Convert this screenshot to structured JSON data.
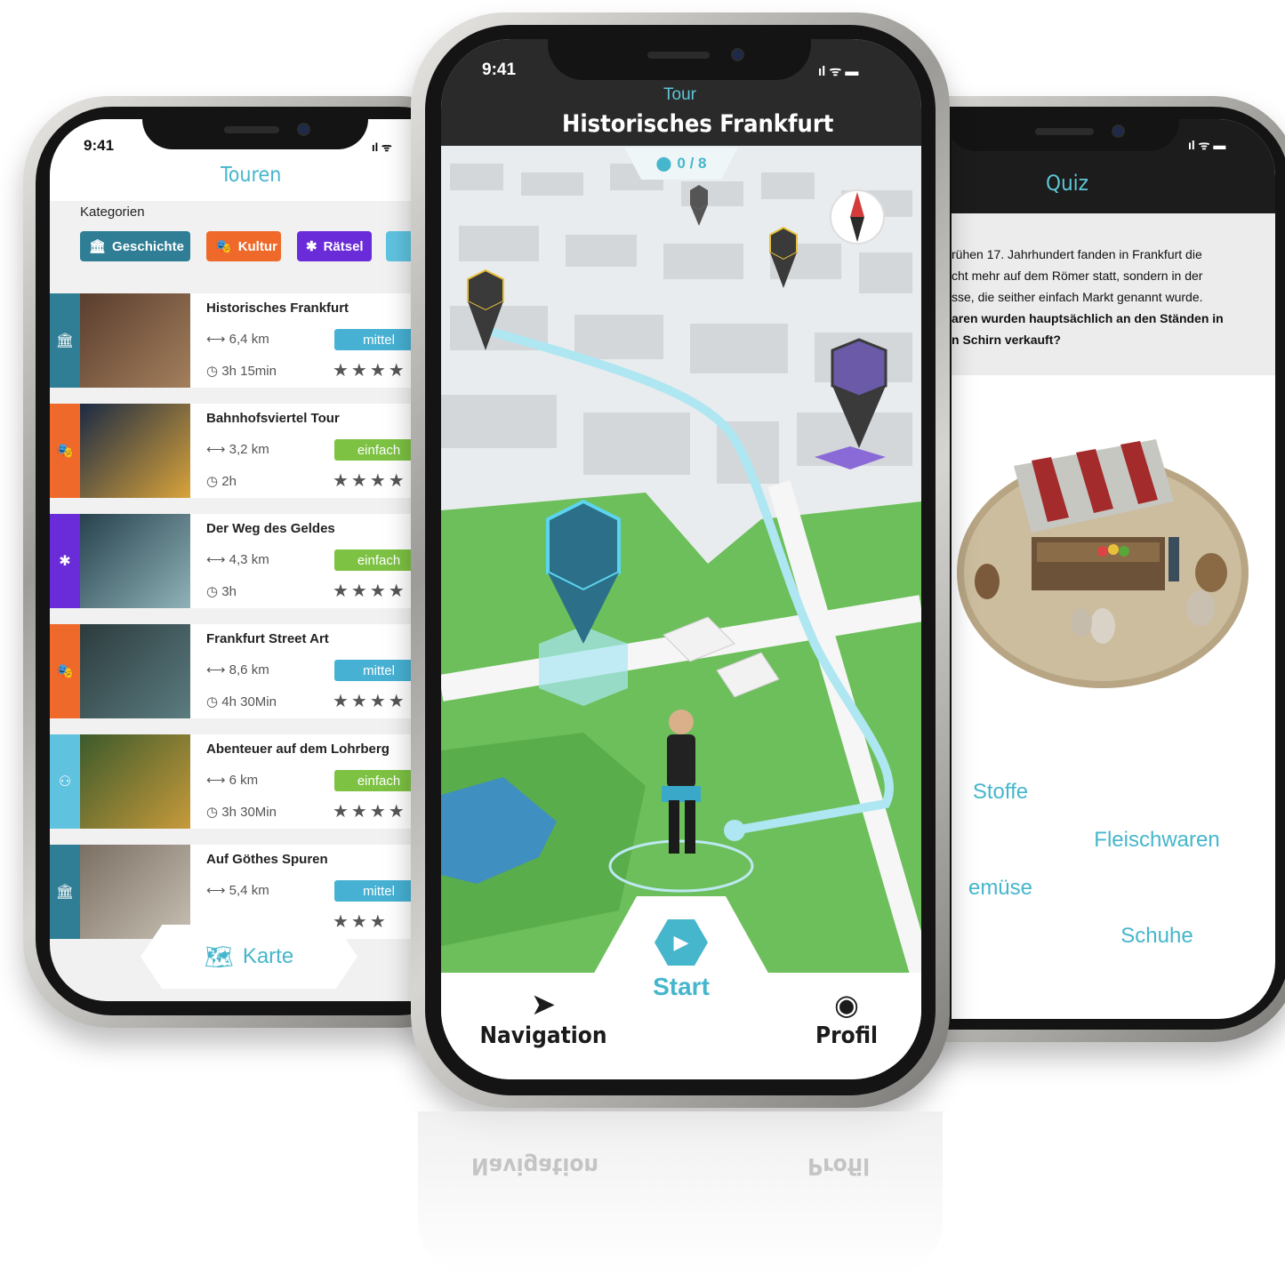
{
  "left_phone": {
    "status_time": "9:41",
    "title": "Touren",
    "categories_label": "Kategorien",
    "categories": [
      {
        "label": "Geschichte",
        "icon": "column-icon",
        "color": "#2f7e95"
      },
      {
        "label": "Kultur",
        "icon": "mask-icon",
        "color": "#ef6a2a"
      },
      {
        "label": "Rätsel",
        "icon": "puzzle-icon",
        "color": "#6a2bd9"
      }
    ],
    "tours": [
      {
        "title": "Historisches Frankfurt",
        "distance": "6,4 km",
        "duration": "3h 15min",
        "level": "mittel",
        "level_color": "#47b1d4",
        "cat_color": "#2f7e95",
        "cat_icon": "column-icon",
        "stars": "★★★★"
      },
      {
        "title": "Bahnhofsviertel Tour",
        "distance": "3,2 km",
        "duration": "2h",
        "level": "einfach",
        "level_color": "#7dc243",
        "cat_color": "#ef6a2a",
        "cat_icon": "mask-icon",
        "stars": "★★★★"
      },
      {
        "title": "Der Weg des Geldes",
        "distance": "4,3 km",
        "duration": "3h",
        "level": "einfach",
        "level_color": "#7dc243",
        "cat_color": "#6a2bd9",
        "cat_icon": "puzzle-icon",
        "stars": "★★★★"
      },
      {
        "title": "Frankfurt Street Art",
        "distance": "8,6 km",
        "duration": "4h 30Min",
        "level": "mittel",
        "level_color": "#47b1d4",
        "cat_color": "#ef6a2a",
        "cat_icon": "mask-icon",
        "stars": "★★★★"
      },
      {
        "title": "Abenteuer auf dem Lohrberg",
        "distance": "6 km",
        "duration": "3h 30Min",
        "level": "einfach",
        "level_color": "#7dc243",
        "cat_color": "#5fc3e0",
        "cat_icon": "family-icon",
        "stars": "★★★★"
      },
      {
        "title": "Auf Göthes Spuren",
        "distance": "5,4 km",
        "duration": "",
        "level": "mittel",
        "level_color": "#47b1d4",
        "cat_color": "#2f7e95",
        "cat_icon": "column-icon",
        "stars": "★★★"
      }
    ],
    "map_button": "Karte"
  },
  "center_phone": {
    "status_time": "9:41",
    "subtitle": "Tour",
    "title": "Historisches Frankfurt",
    "progress": "0 / 8",
    "nav_left": "Navigation",
    "nav_center": "Start",
    "nav_right": "Profil"
  },
  "right_phone": {
    "title": "Quiz",
    "question_lines": [
      "rühen 17. Jahrhundert fanden in Frankfurt die",
      "cht mehr auf dem Römer statt, sondern in der",
      "sse, die seither einfach Markt genannt wurde.",
      "aren wurden hauptsächlich an den Ständen in",
      "n Schirn verkauft?"
    ],
    "answers": [
      "Stoffe",
      "Fleischwaren",
      "emüse",
      "Schuhe"
    ]
  },
  "reflection": {
    "left": "Navigation",
    "right": "Profil"
  }
}
